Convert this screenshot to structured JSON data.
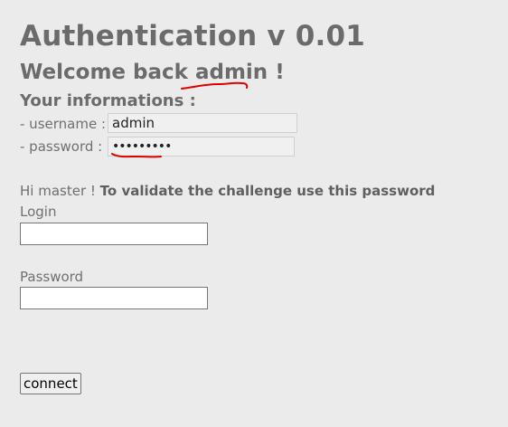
{
  "header": {
    "title": "Authentication v 0.01",
    "welcome_prefix": "Welcome back ",
    "welcome_user": "admin",
    "welcome_suffix": " !"
  },
  "info": {
    "heading": "Your informations :",
    "username_label": "- username :",
    "username_value": "admin",
    "password_label": "- password :",
    "password_value": "•••••••••"
  },
  "hint": {
    "prefix": "Hi master ! ",
    "bold": "To validate the challenge use this password"
  },
  "form": {
    "login_label": "Login",
    "login_value": "",
    "password_label": "Password",
    "password_value": "",
    "connect_label": "connect"
  },
  "annotations": {
    "underline_color": "#e00000"
  }
}
